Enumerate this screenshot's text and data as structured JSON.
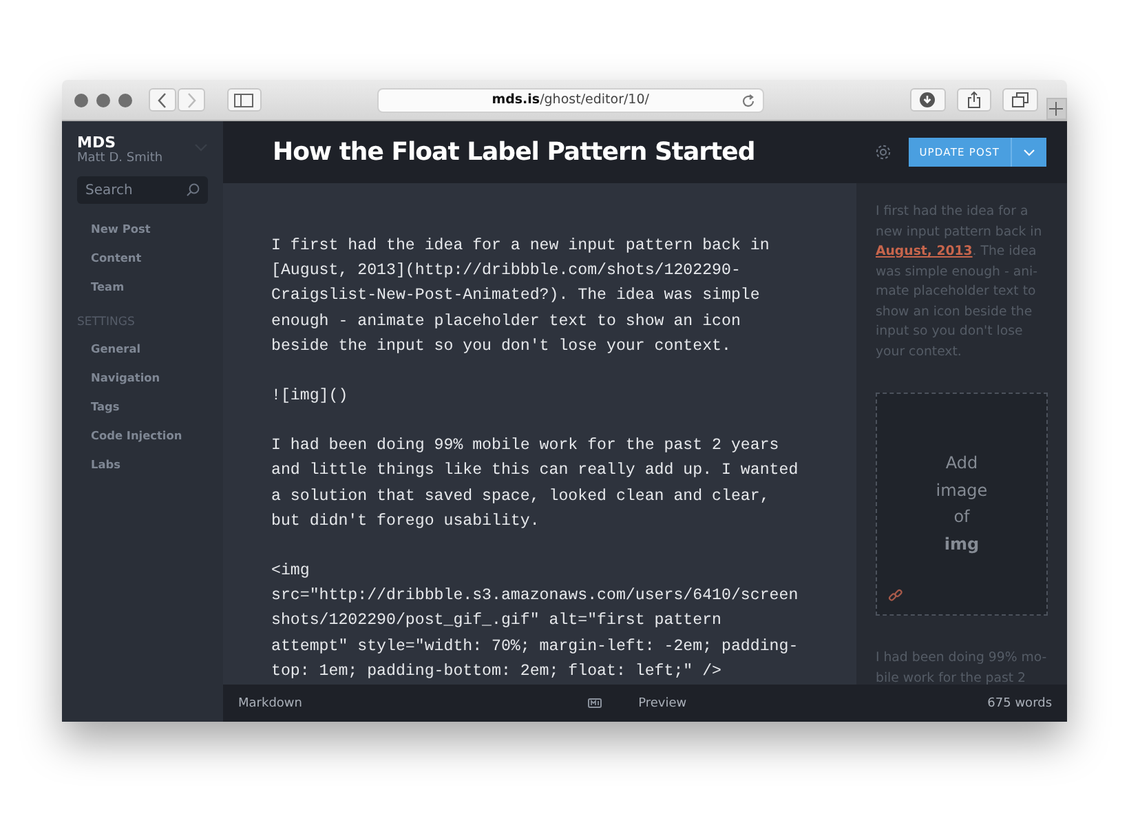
{
  "browser": {
    "url_host": "mds.is",
    "url_path": "/ghost/editor/10/"
  },
  "sidebar": {
    "blog_title": "MDS",
    "user_name": "Matt D. Smith",
    "search": {
      "placeholder": "Search"
    },
    "items": [
      {
        "label": "New Post"
      },
      {
        "label": "Content"
      },
      {
        "label": "Team"
      }
    ],
    "settings_heading": "SETTINGS",
    "settings_items": [
      {
        "label": "General"
      },
      {
        "label": "Navigation"
      },
      {
        "label": "Tags"
      },
      {
        "label": "Code Injection"
      },
      {
        "label": "Labs"
      }
    ]
  },
  "header": {
    "title": "How the Float Label Pattern Started",
    "button": "UPDATE POST"
  },
  "editor": {
    "paragraphs": [
      [
        "I first had the idea for a new input pattern back in",
        "[August, 2013](http://dribbble.com/shots/1202290-",
        "Craigslist-New-Post-Animated?). The idea was simple",
        "enough - animate placeholder text to show an icon",
        "beside the input so you don't lose your context."
      ],
      [
        "![img]()"
      ],
      [
        "I had been doing 99% mobile work for the past 2 years",
        "and little things like this can really add up. I wanted",
        "a solution that saved space, looked clean and clear,",
        "but didn't forego usability."
      ],
      [
        "<img",
        "src=\"http://dribbble.s3.amazonaws.com/users/6410/screen",
        "shots/1202290/post_gif_.gif\" alt=\"first pattern",
        "attempt\" style=\"width: 70%; margin-left: -2em; padding-",
        "top: 1em; padding-bottom: 2em; float: left;\" />"
      ]
    ]
  },
  "preview": {
    "paragraph_1": [
      [
        {
          "kind": "plain",
          "text": "I first had the idea for a"
        }
      ],
      [
        {
          "kind": "plain",
          "text": "new input pattern back in"
        }
      ],
      [
        {
          "kind": "link",
          "text": "August, 2013"
        },
        {
          "kind": "plain",
          "text": ". The idea"
        }
      ],
      [
        {
          "kind": "plain",
          "text": "was simple enough - ani-"
        }
      ],
      [
        {
          "kind": "plain",
          "text": "mate placeholder text to"
        }
      ],
      [
        {
          "kind": "plain",
          "text": "show an icon beside the"
        }
      ],
      [
        {
          "kind": "plain",
          "text": "input so you don't lose"
        }
      ],
      [
        {
          "kind": "plain",
          "text": "your context."
        }
      ]
    ],
    "image_placeholder": {
      "lines": [
        "Add",
        "image",
        "of"
      ],
      "name": "img"
    },
    "paragraph_2": [
      "I had been doing 99% mo-",
      "bile work for the past 2"
    ]
  },
  "footer": {
    "left": "Markdown",
    "preview": "Preview",
    "word_count": "675 words"
  }
}
